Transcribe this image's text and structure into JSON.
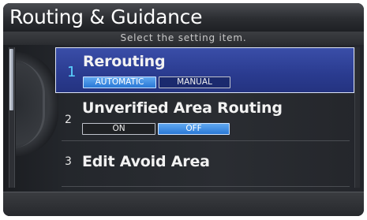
{
  "header": {
    "title": "Routing & Guidance",
    "subtitle": "Select the setting item."
  },
  "menu": {
    "items": [
      {
        "number": "1",
        "label": "Rerouting",
        "selected": true,
        "options": [
          "AUTOMATIC",
          "MANUAL"
        ],
        "active_option": "AUTOMATIC"
      },
      {
        "number": "2",
        "label": "Unverified Area Routing",
        "selected": false,
        "options": [
          "ON",
          "OFF"
        ],
        "active_option": "OFF"
      },
      {
        "number": "3",
        "label": "Edit Avoid Area",
        "selected": false
      }
    ]
  },
  "colors": {
    "selected_row": "#2a3b8f",
    "active_chip": "#2a78d6",
    "selected_number": "#5ad2ff"
  },
  "scrollbar": {
    "thumb_fraction": 0.44
  }
}
